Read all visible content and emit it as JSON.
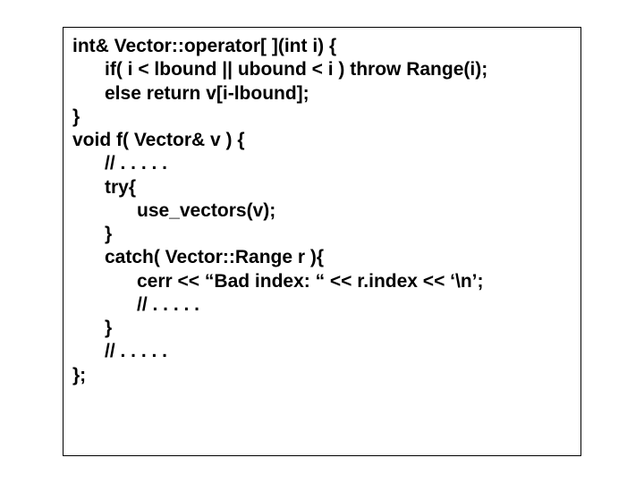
{
  "code": {
    "l1": "int& Vector::operator[ ](int i) {",
    "l2": "if( i < lbound || ubound < i ) throw Range(i);",
    "l3": "else return v[i-lbound];",
    "l4": "}",
    "l5": "void f( Vector& v ) {",
    "l6": "// . . . . .",
    "l7": "try{",
    "l8": "use_vectors(v);",
    "l9": "}",
    "l10": "catch( Vector::Range r ){",
    "l11": "cerr << “Bad index: “ << r.index << ‘\\n’;",
    "l12": "// . . . . .",
    "l13": "}",
    "l14": "// . . . . .",
    "l15": "};"
  }
}
